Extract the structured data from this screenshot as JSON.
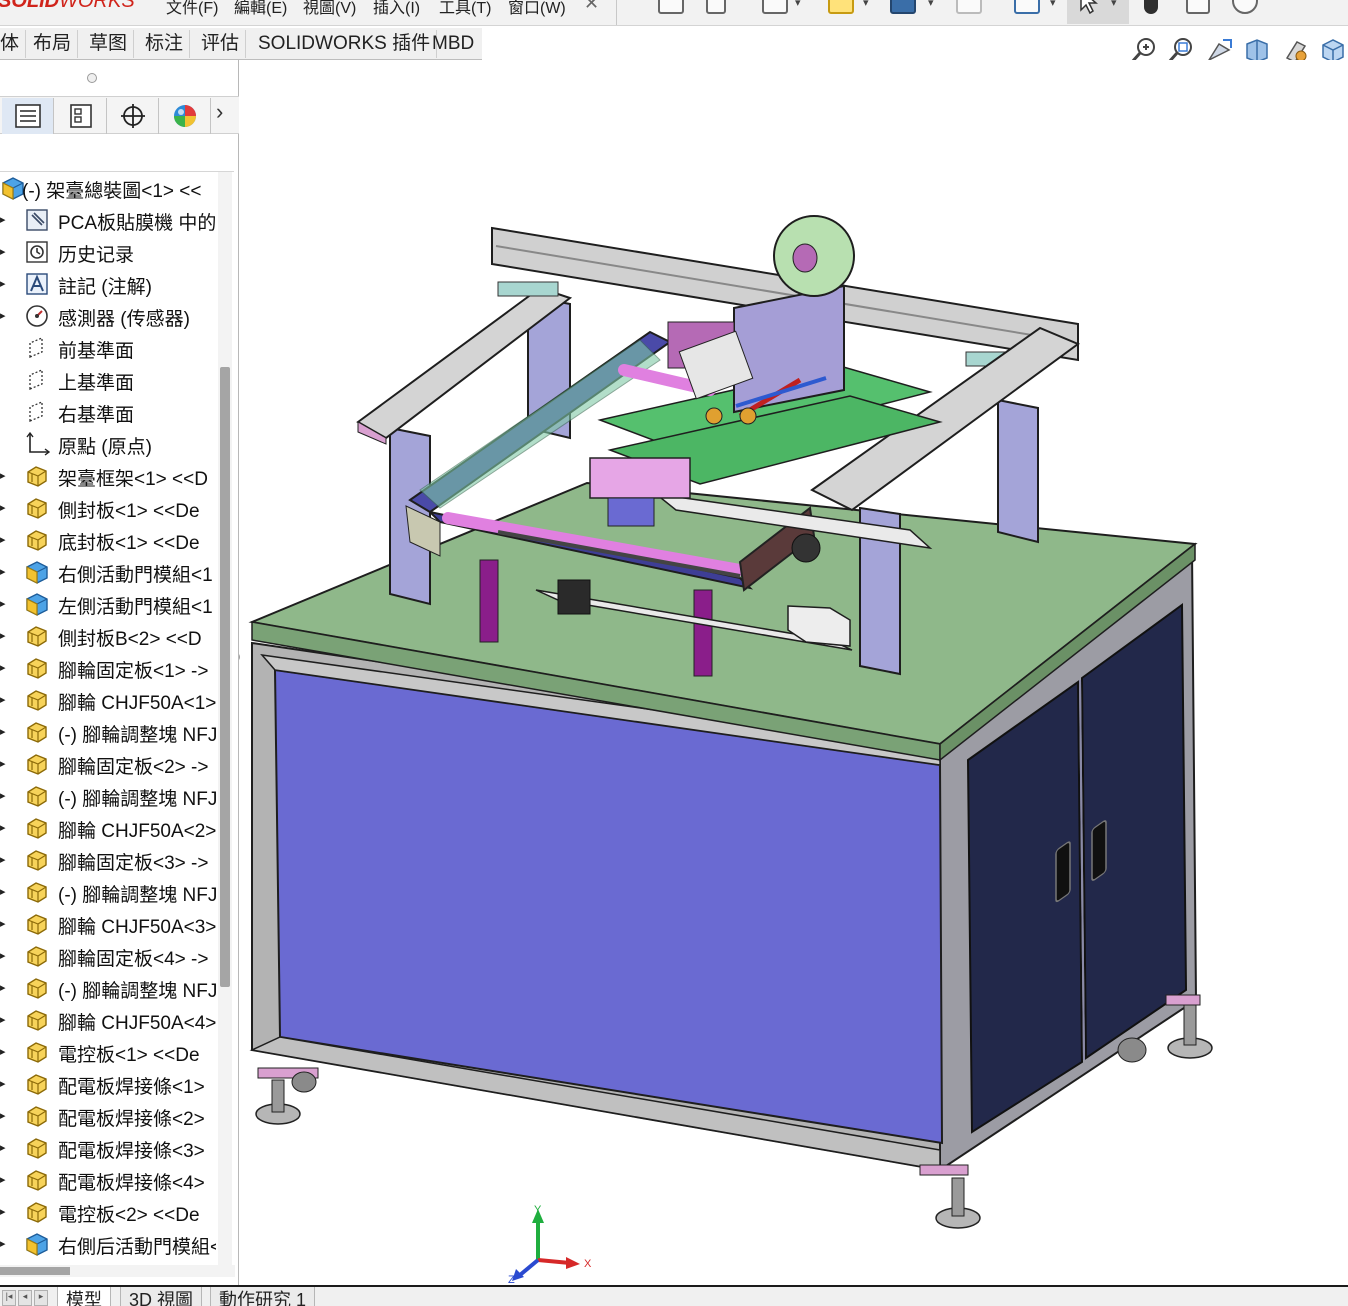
{
  "app": {
    "logo_bold": "SOLID",
    "logo_thin": "WORKS"
  },
  "menu": [
    {
      "label": "文件(F)"
    },
    {
      "label": "編輯(E)"
    },
    {
      "label": "視圖(V)"
    },
    {
      "label": "插入(I)"
    },
    {
      "label": "工具(T)"
    },
    {
      "label": "窗口(W)"
    }
  ],
  "command_tabs": [
    {
      "label": "体"
    },
    {
      "label": "布局"
    },
    {
      "label": "草图"
    },
    {
      "label": "标注"
    },
    {
      "label": "评估"
    },
    {
      "label": "SOLIDWORKS 插件"
    },
    {
      "label": "MBD"
    }
  ],
  "heads_up_icons": [
    "zoom-to-fit-icon",
    "zoom-to-area-icon",
    "previous-view-icon",
    "section-view-icon",
    "dynamic-annotation-icon",
    "view-orientation-icon"
  ],
  "panel_tabs": [
    "feature-manager-icon",
    "property-manager-icon",
    "configuration-manager-icon",
    "appearance-manager-icon"
  ],
  "feature_tree": [
    {
      "label": "(-) 架臺總裝圖<1>  <<",
      "icon": "assembly",
      "root": true
    },
    {
      "label": "PCA板貼膜機 中的配",
      "icon": "sensor"
    },
    {
      "label": "历史记录",
      "icon": "history"
    },
    {
      "label": "註記 (注解)",
      "icon": "annotation"
    },
    {
      "label": "感測器 (传感器)",
      "icon": "gauge"
    },
    {
      "label": "前基準面",
      "icon": "plane",
      "no_toggle": true
    },
    {
      "label": "上基準面",
      "icon": "plane",
      "no_toggle": true
    },
    {
      "label": "右基準面",
      "icon": "plane",
      "no_toggle": true
    },
    {
      "label": "原點 (原点)",
      "icon": "origin",
      "no_toggle": true
    },
    {
      "label": "架臺框架<1>  <<D",
      "icon": "part"
    },
    {
      "label": "側封板<1>  <<De",
      "icon": "part"
    },
    {
      "label": "底封板<1>  <<De",
      "icon": "part"
    },
    {
      "label": "右側活動門模組<1",
      "icon": "assembly"
    },
    {
      "label": "左側活動門模組<1",
      "icon": "assembly"
    },
    {
      "label": "側封板B<2>  <<D",
      "icon": "part"
    },
    {
      "label": "腳輪固定板<1> ->",
      "icon": "part"
    },
    {
      "label": "腳輪 CHJF50A<1>",
      "icon": "part"
    },
    {
      "label": "(-) 腳輪調整塊 NFJ",
      "icon": "part"
    },
    {
      "label": "腳輪固定板<2> ->",
      "icon": "part"
    },
    {
      "label": "(-) 腳輪調整塊 NFJ",
      "icon": "part"
    },
    {
      "label": "腳輪 CHJF50A<2>",
      "icon": "part"
    },
    {
      "label": "腳輪固定板<3> ->",
      "icon": "part"
    },
    {
      "label": "(-) 腳輪調整塊 NFJ",
      "icon": "part"
    },
    {
      "label": "腳輪 CHJF50A<3>",
      "icon": "part"
    },
    {
      "label": "腳輪固定板<4> ->",
      "icon": "part"
    },
    {
      "label": "(-) 腳輪調整塊 NFJ",
      "icon": "part"
    },
    {
      "label": "腳輪 CHJF50A<4>",
      "icon": "part"
    },
    {
      "label": "電控板<1>  <<De",
      "icon": "part"
    },
    {
      "label": "配電板焊接條<1>",
      "icon": "part"
    },
    {
      "label": "配電板焊接條<2>",
      "icon": "part"
    },
    {
      "label": "配電板焊接條<3>",
      "icon": "part"
    },
    {
      "label": "配電板焊接條<4>",
      "icon": "part"
    },
    {
      "label": "電控板<2>  <<De",
      "icon": "part"
    },
    {
      "label": "右側后活動門模組<",
      "icon": "assembly"
    }
  ],
  "bottom_tabs": [
    {
      "label": "模型",
      "active": true
    },
    {
      "label": "3D 視圖"
    },
    {
      "label": "動作研究 1"
    }
  ],
  "triad": {
    "x": "X",
    "y": "Y",
    "z": "Z"
  },
  "colors": {
    "table_top": "#8fb88a",
    "cabinet_panel": "#6a6ad2",
    "door_panel": "#22284a",
    "frame": "#b3b3b3",
    "rail": "#c8c8c8",
    "pink_rod": "#e080e0",
    "support": "#a4a4d8",
    "conveyor": "#55c06e",
    "part_icon": "#f2c230",
    "assembly_icon": "#3a8ad0",
    "logo": "#d0241b"
  }
}
